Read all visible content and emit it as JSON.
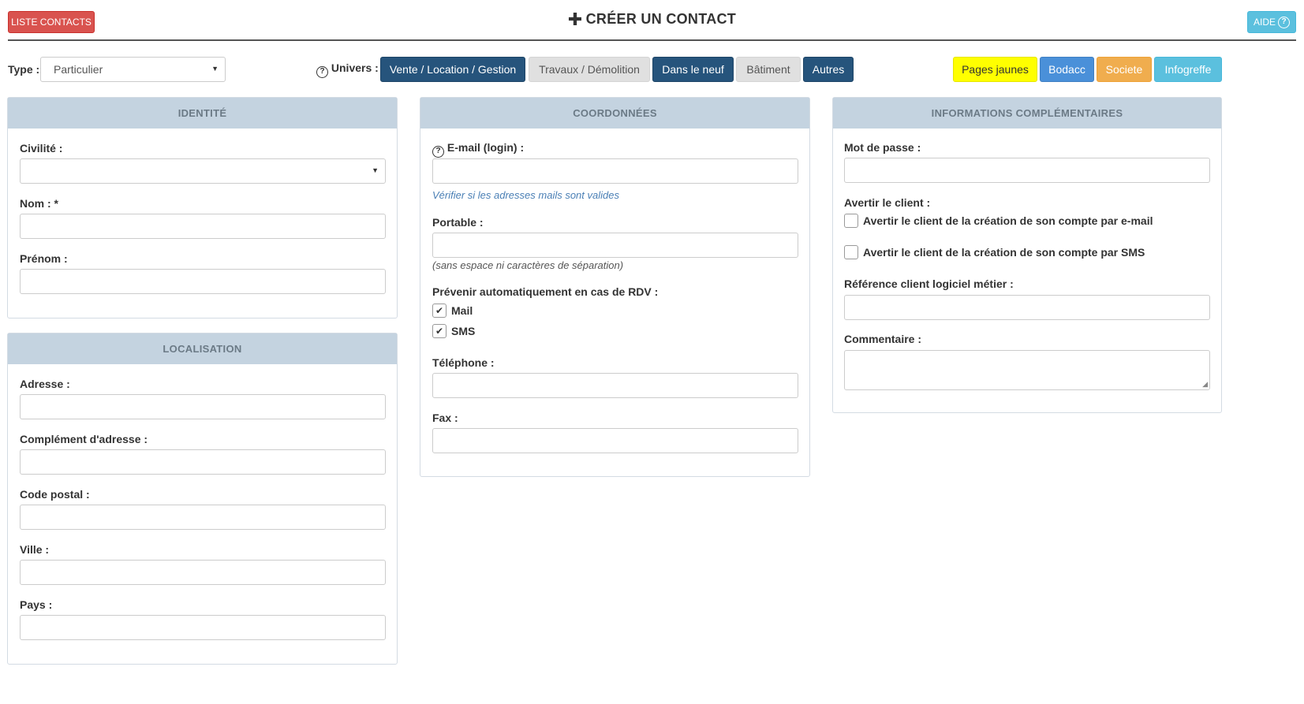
{
  "header": {
    "list_button": "LISTE CONTACTS",
    "title": "CRÉER UN CONTACT",
    "help_button": "AIDE"
  },
  "typebar": {
    "type_label": "Type :",
    "type_value": "Particulier",
    "univers_label": "Univers :",
    "univers_buttons": [
      {
        "label": "Vente / Location / Gestion",
        "active": true
      },
      {
        "label": "Travaux / Démolition",
        "active": false
      },
      {
        "label": "Dans le neuf",
        "active": true
      },
      {
        "label": "Bâtiment",
        "active": false
      },
      {
        "label": "Autres",
        "active": true
      }
    ],
    "external_buttons": [
      {
        "label": "Pages jaunes",
        "color": "#ffff00"
      },
      {
        "label": "Bodacc",
        "color": "#4a90d9"
      },
      {
        "label": "Societe",
        "color": "#f0ad4e"
      },
      {
        "label": "Infogreffe",
        "color": "#5bc0de"
      }
    ]
  },
  "identite": {
    "title": "IDENTITÉ",
    "civilite_label": "Civilité :",
    "nom_label": "Nom : *",
    "prenom_label": "Prénom :"
  },
  "localisation": {
    "title": "LOCALISATION",
    "adresse_label": "Adresse :",
    "complement_label": "Complément d'adresse :",
    "code_postal_label": "Code postal :",
    "ville_label": "Ville :",
    "pays_label": "Pays :"
  },
  "coordonnees": {
    "title": "COORDONNÉES",
    "email_label": "E-mail (login) :",
    "email_hint": "Vérifier si les adresses mails sont valides",
    "portable_label": "Portable :",
    "portable_hint": "(sans espace ni caractères de séparation)",
    "prevenir_label": "Prévenir automatiquement en cas de RDV :",
    "mail_label": "Mail",
    "mail_checked": true,
    "sms_label": "SMS",
    "sms_checked": true,
    "telephone_label": "Téléphone :",
    "fax_label": "Fax :"
  },
  "infos": {
    "title": "INFORMATIONS COMPLÉMENTAIRES",
    "password_label": "Mot de passe :",
    "avertir_label": "Avertir le client :",
    "avertir_email_label": "Avertir le client de la création de son compte par e-mail",
    "avertir_email_checked": false,
    "avertir_sms_label": "Avertir le client de la création de son compte par SMS",
    "avertir_sms_checked": false,
    "reference_label": "Référence client logiciel métier :",
    "commentaire_label": "Commentaire :"
  }
}
